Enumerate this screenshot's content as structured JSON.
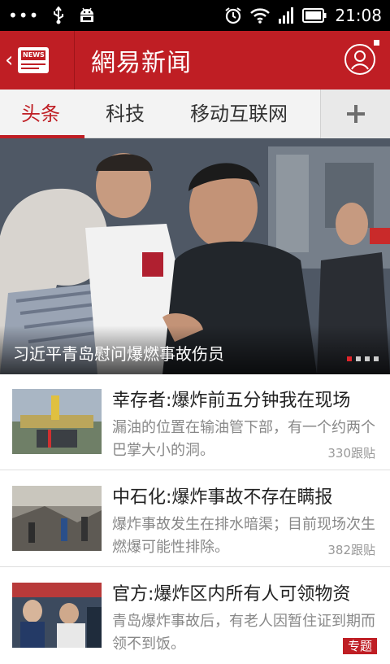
{
  "status_bar": {
    "time": "21:08",
    "icons": [
      "more-dots-icon",
      "usb-icon",
      "android-debug-icon",
      "alarm-icon",
      "wifi-icon",
      "signal-icon",
      "battery-icon"
    ]
  },
  "header": {
    "logo_text": "NEWS",
    "title": "網易新闻",
    "brand_color": "#bf1e24"
  },
  "tabs": [
    {
      "label": "头条",
      "active": true
    },
    {
      "label": "科技",
      "active": false
    },
    {
      "label": "移动互联网",
      "active": false
    }
  ],
  "hero": {
    "caption": "习近平青岛慰问爆燃事故伤员",
    "page_count": 4,
    "current_page": 1
  },
  "news": [
    {
      "title": "幸存者:爆炸前五分钟我在现场",
      "summary": "漏油的位置在输油管下部，有一个约两个巴掌大小的洞。",
      "count": "330跟贴"
    },
    {
      "title": "中石化:爆炸事故不存在瞒报",
      "summary": "爆炸事故发生在排水暗渠；目前现场次生燃爆可能性排除。",
      "count": "382跟贴"
    },
    {
      "title": "官方:爆炸区内所有人可领物资",
      "summary": "青岛爆炸事故后，有老人因暂住证到期而领不到饭。",
      "badge": "专题"
    }
  ]
}
